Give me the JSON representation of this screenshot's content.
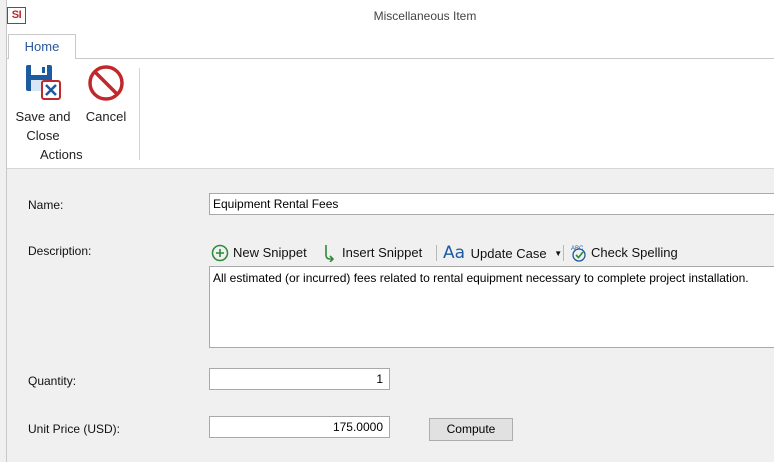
{
  "window": {
    "title": "Miscellaneous Item",
    "logo_text": "SI"
  },
  "ribbon": {
    "tabs": [
      {
        "label": "Home"
      }
    ],
    "buttons": {
      "save_line1": "Save and",
      "save_line2": "Close",
      "cancel": "Cancel"
    },
    "group_label": "Actions"
  },
  "form": {
    "name": {
      "label": "Name:",
      "value": "Equipment Rental Fees"
    },
    "description": {
      "label": "Description:",
      "toolbar": {
        "new_snippet": "New Snippet",
        "insert_snippet": "Insert Snippet",
        "update_case": "Update Case",
        "check_spelling": "Check Spelling"
      },
      "value": "All estimated (or incurred) fees related to rental equipment necessary to complete project installation."
    },
    "quantity": {
      "label": "Quantity:",
      "value": "1"
    },
    "unit_price": {
      "label": "Unit Price (USD):",
      "value": "175.0000"
    },
    "compute_label": "Compute"
  },
  "colors": {
    "accent_blue": "#2b579a",
    "cancel_red": "#c0282c",
    "form_bg": "#f0f0f0"
  },
  "icons": [
    "save-close-icon",
    "cancel-icon",
    "new-snippet-icon",
    "insert-snippet-icon",
    "update-case-icon",
    "dropdown-arrow-icon",
    "check-spelling-icon"
  ]
}
